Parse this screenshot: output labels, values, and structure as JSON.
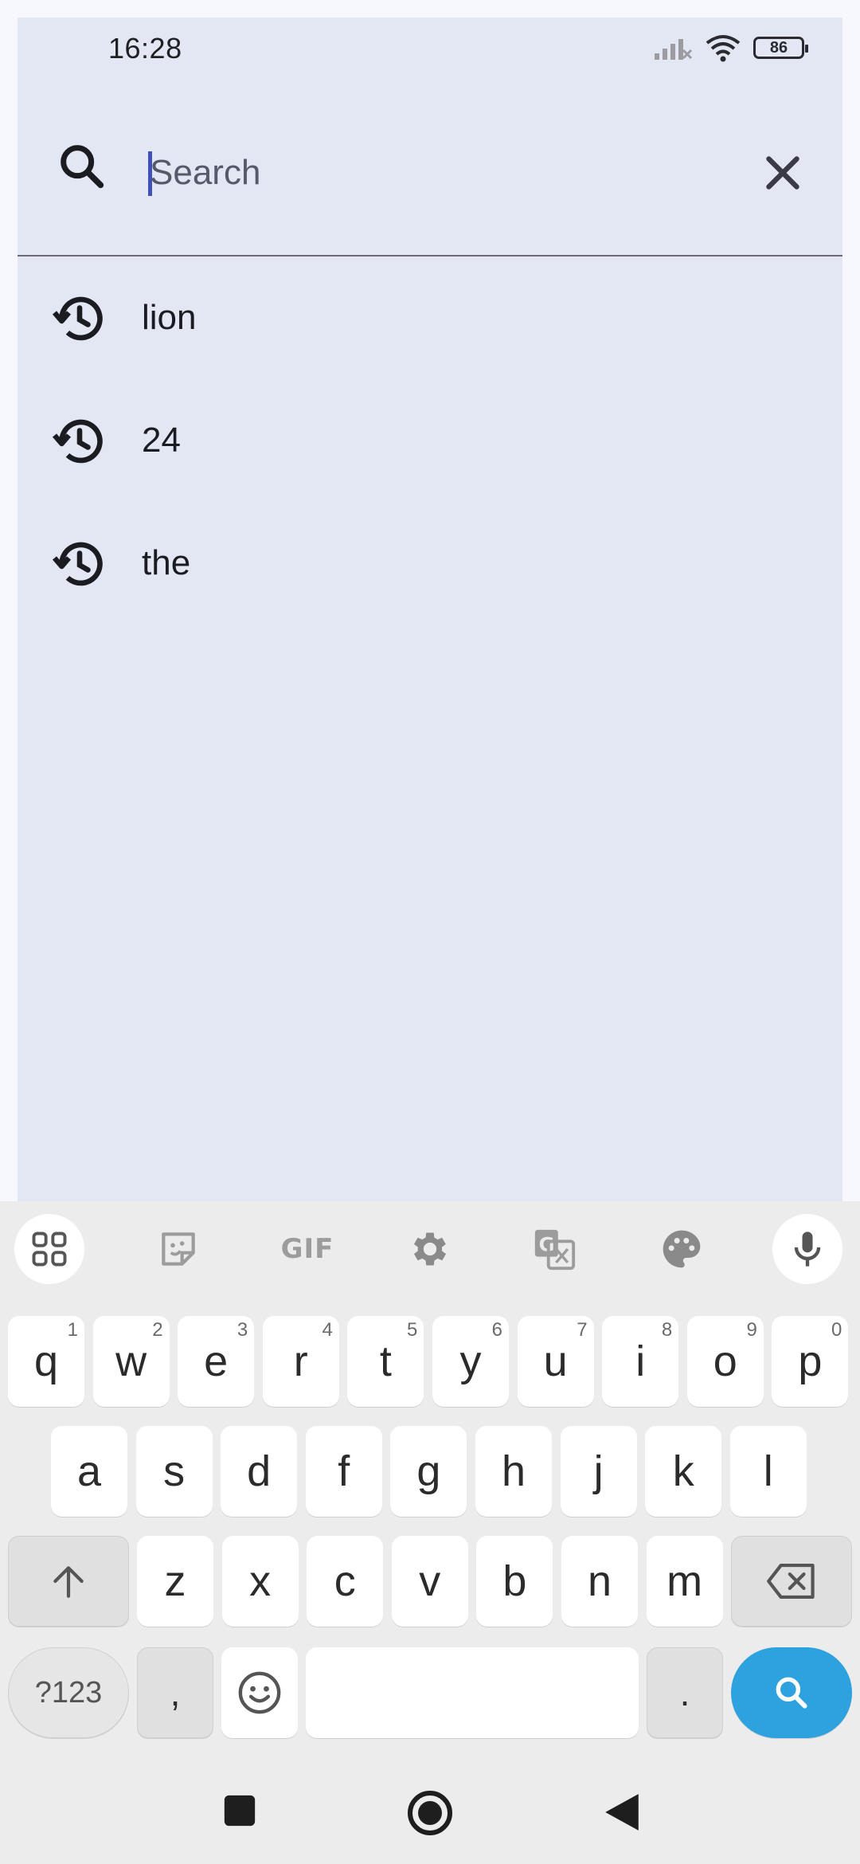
{
  "status_bar": {
    "time": "16:28",
    "battery": "86"
  },
  "search": {
    "placeholder": "Search"
  },
  "history": [
    {
      "label": "lion"
    },
    {
      "label": "24"
    },
    {
      "label": "the"
    }
  ],
  "keyboard": {
    "toolbar": {
      "gif_label": "GIF"
    },
    "row1": [
      {
        "k": "q",
        "h": "1"
      },
      {
        "k": "w",
        "h": "2"
      },
      {
        "k": "e",
        "h": "3"
      },
      {
        "k": "r",
        "h": "4"
      },
      {
        "k": "t",
        "h": "5"
      },
      {
        "k": "y",
        "h": "6"
      },
      {
        "k": "u",
        "h": "7"
      },
      {
        "k": "i",
        "h": "8"
      },
      {
        "k": "o",
        "h": "9"
      },
      {
        "k": "p",
        "h": "0"
      }
    ],
    "row2": [
      "a",
      "s",
      "d",
      "f",
      "g",
      "h",
      "j",
      "k",
      "l"
    ],
    "row3": [
      "z",
      "x",
      "c",
      "v",
      "b",
      "n",
      "m"
    ],
    "num_label": "?123",
    "comma": ",",
    "period": "."
  },
  "colors": {
    "accent": "#2ea1df",
    "surface": "#e3e7f3",
    "caret": "#3f51b5"
  }
}
